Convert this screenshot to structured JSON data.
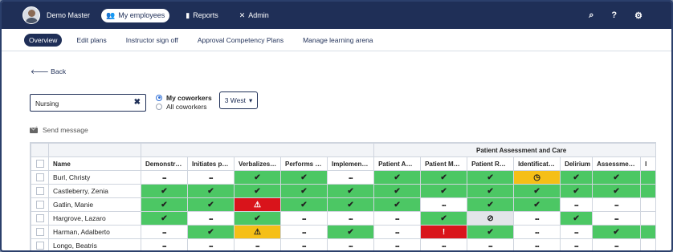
{
  "topbar": {
    "user": "Demo Master",
    "nav": [
      {
        "label": "My employees",
        "icon": "people-icon",
        "active": true
      },
      {
        "label": "Reports",
        "icon": "bar-chart-icon",
        "active": false
      },
      {
        "label": "Admin",
        "icon": "tools-icon",
        "active": false
      }
    ],
    "right_icons": [
      "search-icon",
      "help-icon",
      "gear-icon"
    ],
    "right_glyphs": [
      "⌕",
      "?",
      "⚙"
    ]
  },
  "subnav": [
    "Overview",
    "Edit plans",
    "Instructor sign off",
    "Approval Competency Plans",
    "Manage learning arena"
  ],
  "back_label": "Back",
  "search": {
    "value": "Nursing"
  },
  "filters": {
    "radio": [
      {
        "label": "My coworkers",
        "selected": true
      },
      {
        "label": "All coworkers",
        "selected": false
      }
    ],
    "unit": "3 West"
  },
  "send_message": "Send message",
  "table": {
    "group_header": "Patient Assessment and Care",
    "name_header": "Name",
    "columns": [
      "Demonstr…",
      "Initiates p…",
      "Verbalizes…",
      "Performs …",
      "Implemen…",
      "Patient A…",
      "Patient M…",
      "Patient R…",
      "Identificat…",
      "Delirium",
      "Assessme…",
      "I"
    ],
    "rows": [
      {
        "name": "Burl, Christy",
        "cells": [
          "dots",
          "dots",
          "check",
          "check",
          "dots",
          "check",
          "check",
          "check",
          "clock",
          "check",
          "check",
          "green"
        ]
      },
      {
        "name": "Castleberry, Zenia",
        "cells": [
          "check",
          "check",
          "check",
          "check",
          "check",
          "check",
          "check",
          "check",
          "check",
          "check",
          "check",
          "green"
        ]
      },
      {
        "name": "Gatlin, Manie",
        "cells": [
          "check",
          "check",
          "warn-red",
          "check",
          "check",
          "check",
          "dots",
          "check",
          "check",
          "dots",
          "dots",
          "white"
        ]
      },
      {
        "name": "Hargrove, Lazaro",
        "cells": [
          "check",
          "dots",
          "check",
          "dots",
          "dots",
          "dots",
          "check",
          "blocked",
          "dots",
          "check",
          "dots",
          "white"
        ]
      },
      {
        "name": "Harman, Adalberto",
        "cells": [
          "dots",
          "check",
          "warn-yellow",
          "dots",
          "check",
          "dots",
          "exclaim",
          "check",
          "dots",
          "dots",
          "check",
          "green"
        ]
      },
      {
        "name": "Longo, Beatris",
        "cells": [
          "dots",
          "dots",
          "dots",
          "dots",
          "dots",
          "dots",
          "dots",
          "dots",
          "dots",
          "dots",
          "dots",
          "white"
        ]
      }
    ]
  },
  "colors": {
    "navy": "#1f2f57",
    "green": "#4cc764",
    "red": "#d9141b",
    "yellow": "#f5bf17"
  }
}
